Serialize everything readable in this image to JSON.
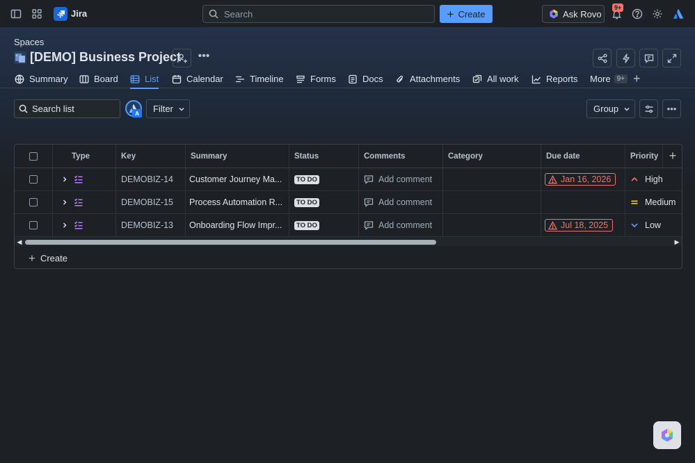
{
  "app": {
    "name": "Jira"
  },
  "topbar": {
    "search_placeholder": "Search",
    "create_label": "Create",
    "rovo_label": "Ask Rovo",
    "notifications_badge": "9+"
  },
  "header": {
    "breadcrumb": "Spaces",
    "project_title": "[DEMO] Business Project"
  },
  "tabs": [
    {
      "label": "Summary",
      "icon": "globe-icon"
    },
    {
      "label": "Board",
      "icon": "board-icon"
    },
    {
      "label": "List",
      "icon": "list-icon",
      "active": true
    },
    {
      "label": "Calendar",
      "icon": "calendar-icon"
    },
    {
      "label": "Timeline",
      "icon": "timeline-icon"
    },
    {
      "label": "Forms",
      "icon": "forms-icon"
    },
    {
      "label": "Docs",
      "icon": "docs-icon"
    },
    {
      "label": "Attachments",
      "icon": "attachment-icon"
    },
    {
      "label": "All work",
      "icon": "all-work-icon"
    },
    {
      "label": "Reports",
      "icon": "reports-icon"
    },
    {
      "label": "More",
      "badge": "9+"
    }
  ],
  "toolbar": {
    "search_list_placeholder": "Search list",
    "avatar_initial": "A",
    "filter_label": "Filter",
    "group_label": "Group"
  },
  "table": {
    "columns": [
      "Type",
      "Key",
      "Summary",
      "Status",
      "Comments",
      "Category",
      "Due date",
      "Priority"
    ],
    "rows": [
      {
        "key": "DEMOBIZ-14",
        "summary": "Customer Journey Ma...",
        "status": "TO DO",
        "comment": "Add comment",
        "category": "",
        "due": "Jan 16, 2026",
        "priority": "High"
      },
      {
        "key": "DEMOBIZ-15",
        "summary": "Process Automation R...",
        "status": "TO DO",
        "comment": "Add comment",
        "category": "",
        "due": "",
        "priority": "Medium"
      },
      {
        "key": "DEMOBIZ-13",
        "summary": "Onboarding Flow Impr...",
        "status": "TO DO",
        "comment": "Add comment",
        "category": "",
        "due": "Jul 18, 2025",
        "priority": "Low"
      }
    ],
    "create_label": "Create"
  },
  "colors": {
    "accent": "#579dff",
    "background": "#1d2125",
    "overdue": "#f87168",
    "priority_high": "#f87168",
    "priority_medium": "#f5cd47",
    "priority_low": "#579dff",
    "type_icon": "#b57dff"
  }
}
